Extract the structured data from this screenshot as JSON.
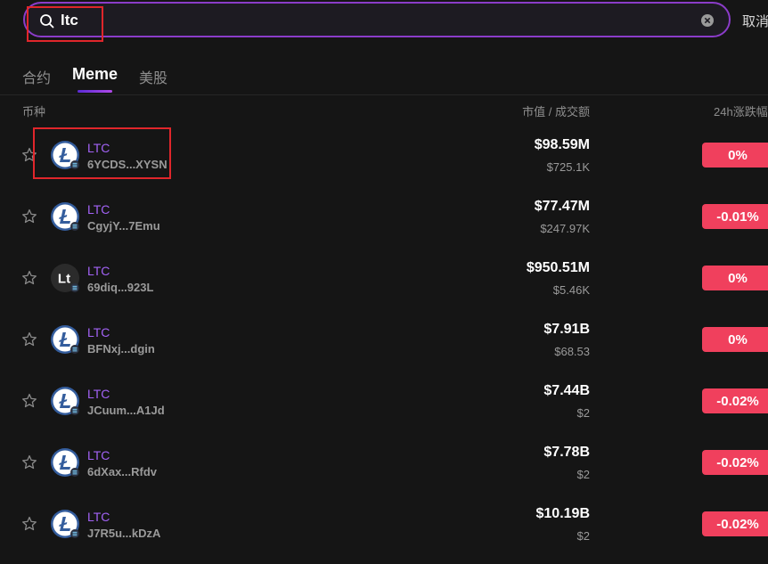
{
  "search": {
    "value": "ltc",
    "cancel_label": "取消"
  },
  "tabs": [
    {
      "label": "合约",
      "active": false
    },
    {
      "label": "Meme",
      "active": true
    },
    {
      "label": "美股",
      "active": false
    }
  ],
  "columns": {
    "coin": "币种",
    "mcap_volume": "市值 / 成交额",
    "change": "24h涨跌幅"
  },
  "colors": {
    "accent": "#a262f5",
    "negative": "#f0405d",
    "border": "#8b3cc9"
  },
  "rows": [
    {
      "name": "LTC",
      "address": "6YCDS...XYSN",
      "logo": "litecoin-logo",
      "market_cap": "$98.59M",
      "volume": "$725.1K",
      "change": "0%"
    },
    {
      "name": "LTC",
      "address": "CgyjY...7Emu",
      "logo": "litecoin-logo",
      "market_cap": "$77.47M",
      "volume": "$247.97K",
      "change": "-0.01%"
    },
    {
      "name": "LTC",
      "address": "69diq...923L",
      "logo": "lt-text-logo",
      "logo_text": "Lt",
      "market_cap": "$950.51M",
      "volume": "$5.46K",
      "change": "0%"
    },
    {
      "name": "LTC",
      "address": "BFNxj...dgin",
      "logo": "litecoin-logo",
      "market_cap": "$7.91B",
      "volume": "$68.53",
      "change": "0%"
    },
    {
      "name": "LTC",
      "address": "JCuum...A1Jd",
      "logo": "litecoin-logo",
      "market_cap": "$7.44B",
      "volume": "$2",
      "change": "-0.02%"
    },
    {
      "name": "LTC",
      "address": "6dXax...Rfdv",
      "logo": "litecoin-logo",
      "market_cap": "$7.78B",
      "volume": "$2",
      "change": "-0.02%"
    },
    {
      "name": "LTC",
      "address": "J7R5u...kDzA",
      "logo": "litecoin-logo",
      "market_cap": "$10.19B",
      "volume": "$2",
      "change": "-0.02%"
    }
  ]
}
